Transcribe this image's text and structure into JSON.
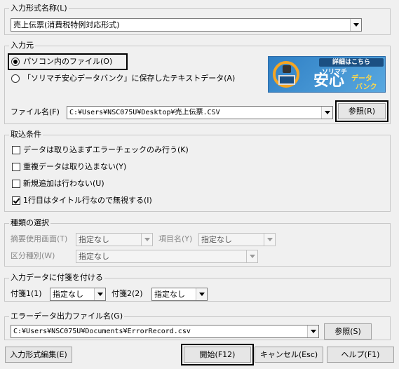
{
  "input_format": {
    "group_label": "入力形式名称(L)",
    "selected": "売上伝票(消費税特例対応形式)"
  },
  "input_source": {
    "group_label": "入力元",
    "option_pc": "パソコン内のファイル(O)",
    "option_bank": "「ソリマチ安心データバンク」に保存したテキストデータ(A)",
    "selected_option": "pc",
    "filename_label": "ファイル名(F)",
    "filename_value": "C:¥Users¥NSC075U¥Desktop¥売上伝票.CSV",
    "browse_label": "参照(R)",
    "banner": {
      "top_text": "詳細はこちら",
      "brand": "ソリマチ",
      "main": "安心",
      "sub1": "データ",
      "sub2": "バンク"
    }
  },
  "import_conditions": {
    "group_label": "取込条件",
    "options": [
      {
        "label": "データは取り込まずエラーチェックのみ行う(K)",
        "checked": false
      },
      {
        "label": "重複データは取り込まない(Y)",
        "checked": false
      },
      {
        "label": "新規追加は行わない(U)",
        "checked": false
      },
      {
        "label": "1行目はタイトル行なので無視する(I)",
        "checked": true
      }
    ]
  },
  "type_select": {
    "group_label": "種類の選択",
    "summary_label": "摘要使用画面(T)",
    "summary_value": "指定なし",
    "item_label": "項目名(Y)",
    "item_value": "指定なし",
    "category_label": "区分種別(W)",
    "category_value": "指定なし"
  },
  "sticky": {
    "group_label": "入力データに付箋を付ける",
    "tag1_label": "付箋1(1)",
    "tag1_value": "指定なし",
    "tag2_label": "付箋2(2)",
    "tag2_value": "指定なし"
  },
  "error_output": {
    "group_label": "エラーデータ出力ファイル名(G)",
    "path": "C:¥Users¥NSC075U¥Documents¥ErrorRecord.csv",
    "browse_label": "参照(S)"
  },
  "footer": {
    "edit_format": "入力形式編集(E)",
    "start": "開始(F12)",
    "cancel": "キャンセル(Esc)",
    "help": "ヘルプ(F1)"
  },
  "colors": {
    "background": "#f0f0f0",
    "banner_blue": "#2f7fc4",
    "banner_orange": "#f5a623"
  }
}
